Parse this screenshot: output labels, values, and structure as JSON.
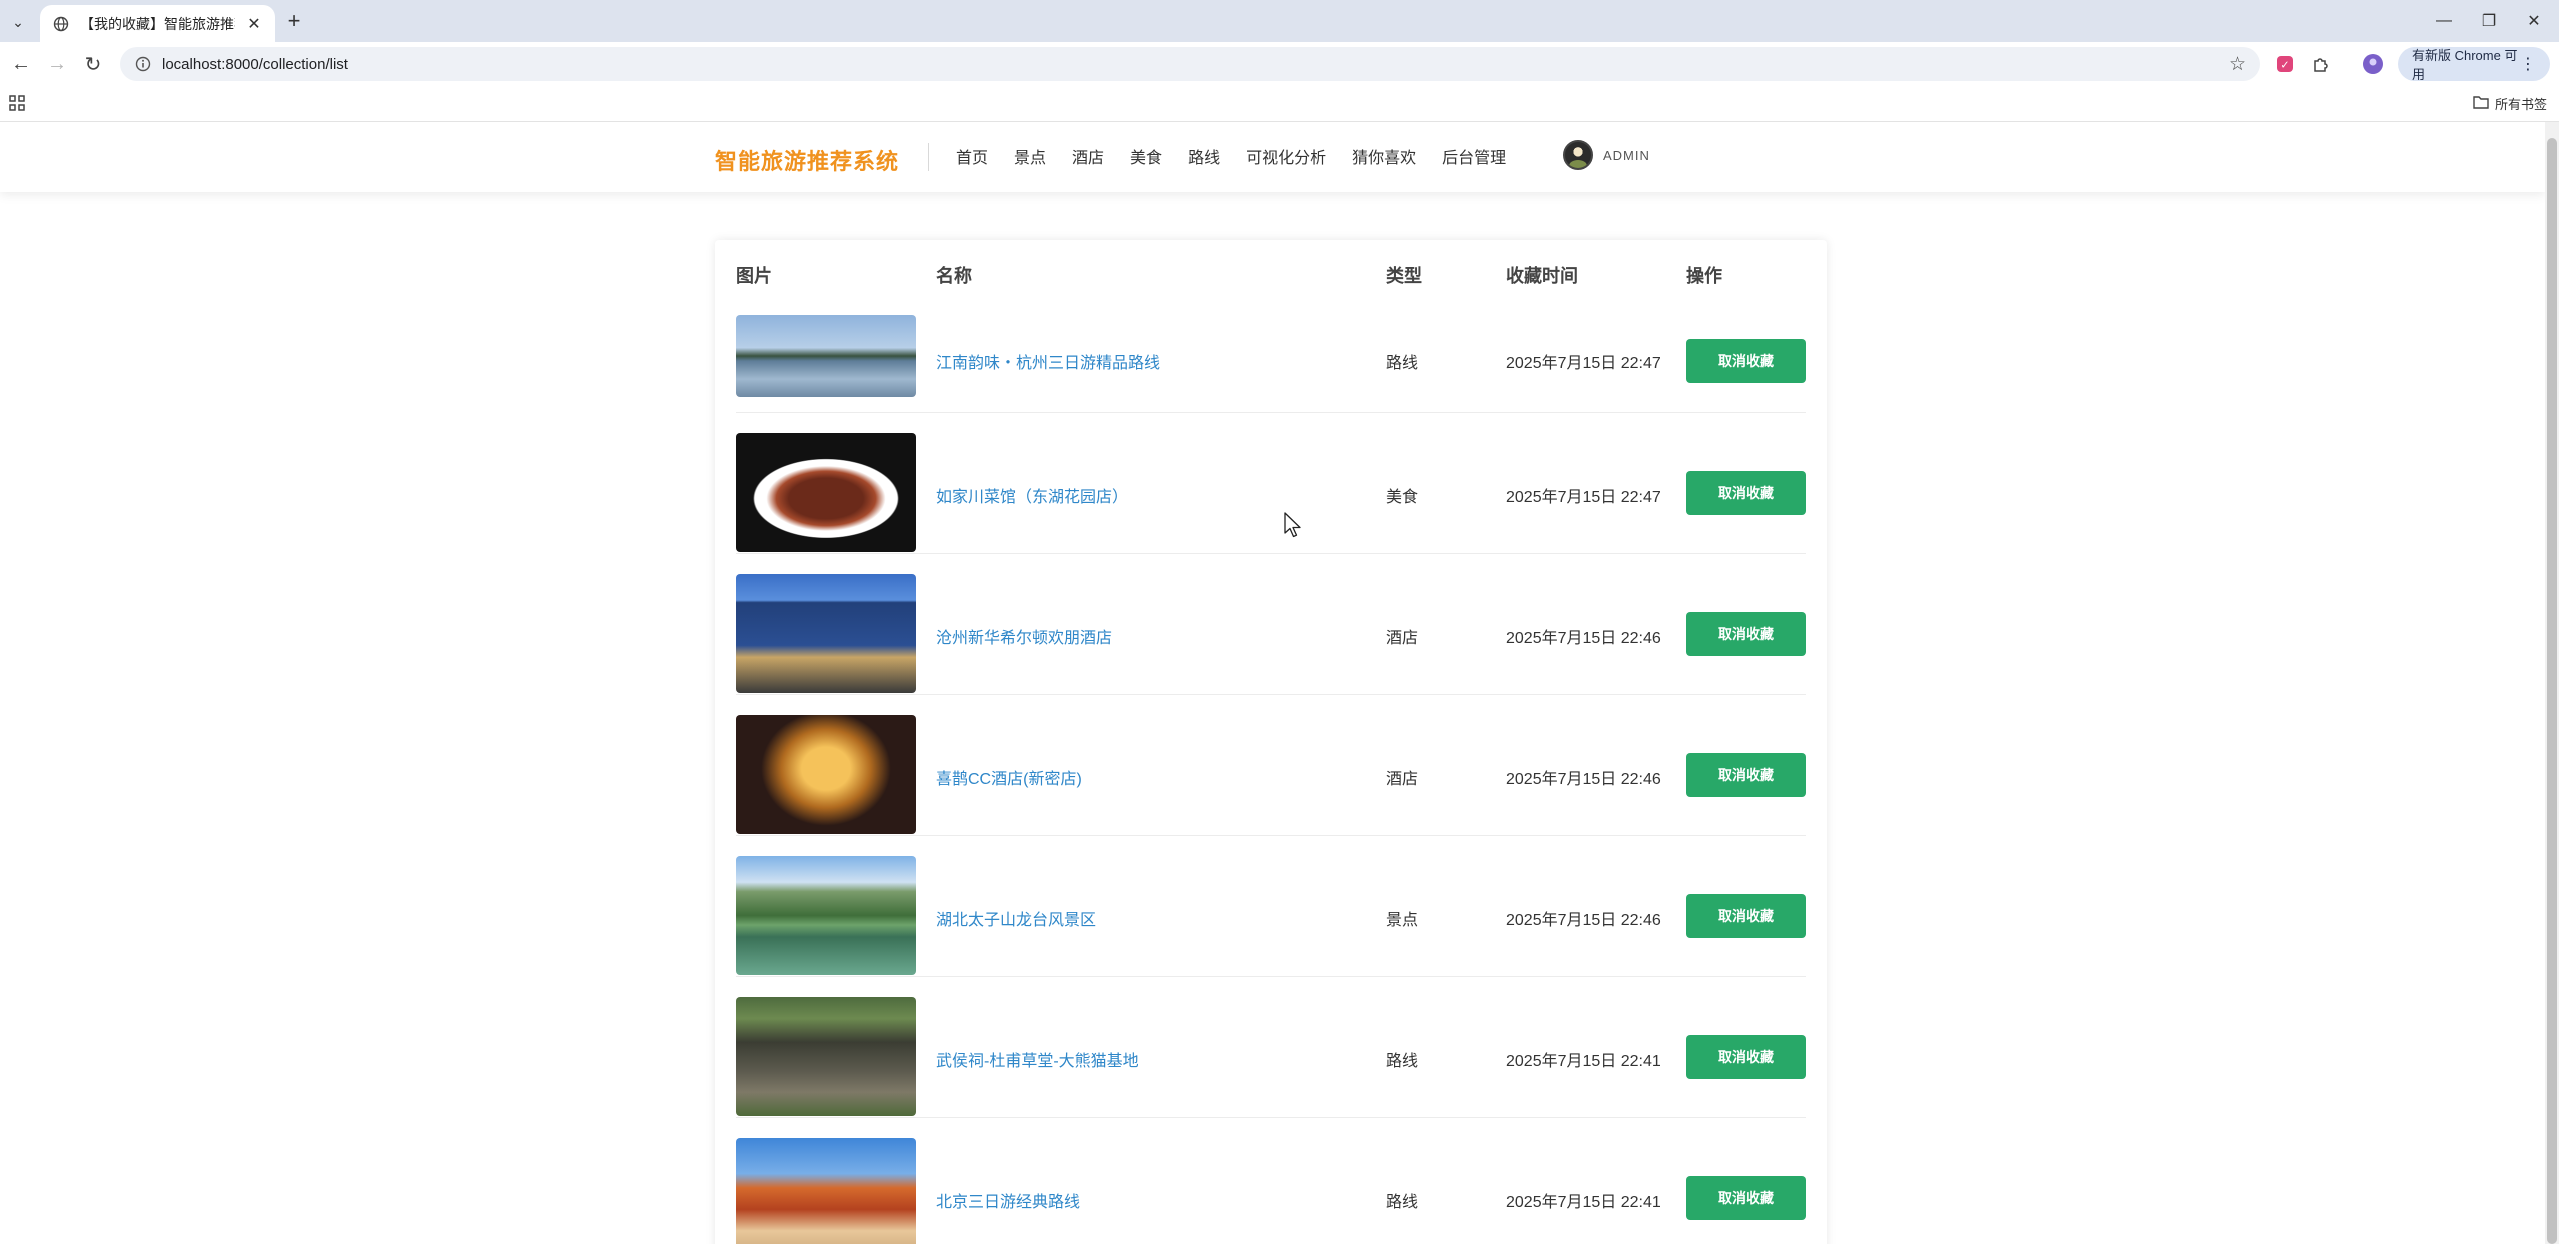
{
  "browser": {
    "tab_title": "【我的收藏】智能旅游推荐系统",
    "url": "localhost:8000/collection/list",
    "update_chip": "有新版 Chrome 可用",
    "all_bookmarks": "所有书签"
  },
  "site": {
    "logo": "智能旅游推荐系统",
    "nav": [
      "首页",
      "景点",
      "酒店",
      "美食",
      "路线",
      "可视化分析",
      "猜你喜欢",
      "后台管理"
    ],
    "username": "ADMIN"
  },
  "table": {
    "headers": {
      "image": "图片",
      "name": "名称",
      "type": "类型",
      "time": "收藏时间",
      "action": "操作"
    },
    "rows": [
      {
        "name": "江南韵味・杭州三日游精品路线",
        "type": "路线",
        "time": "2025年7月15日 22:47",
        "action": "取消收藏"
      },
      {
        "name": "如家川菜馆（东湖花园店）",
        "type": "美食",
        "time": "2025年7月15日 22:47",
        "action": "取消收藏"
      },
      {
        "name": "沧州新华希尔顿欢朋酒店",
        "type": "酒店",
        "time": "2025年7月15日 22:46",
        "action": "取消收藏"
      },
      {
        "name": "喜鹊CC酒店(新密店)",
        "type": "酒店",
        "time": "2025年7月15日 22:46",
        "action": "取消收藏"
      },
      {
        "name": "湖北太子山龙台风景区",
        "type": "景点",
        "time": "2025年7月15日 22:46",
        "action": "取消收藏"
      },
      {
        "name": "武侯祠-杜甫草堂-大熊猫基地",
        "type": "路线",
        "time": "2025年7月15日 22:41",
        "action": "取消收藏"
      },
      {
        "name": "北京三日游经典路线",
        "type": "路线",
        "time": "2025年7月15日 22:41",
        "action": "取消收藏"
      }
    ]
  },
  "colors": {
    "logo": "#f0921f",
    "link": "#2f87c9",
    "button": "#28a868"
  }
}
